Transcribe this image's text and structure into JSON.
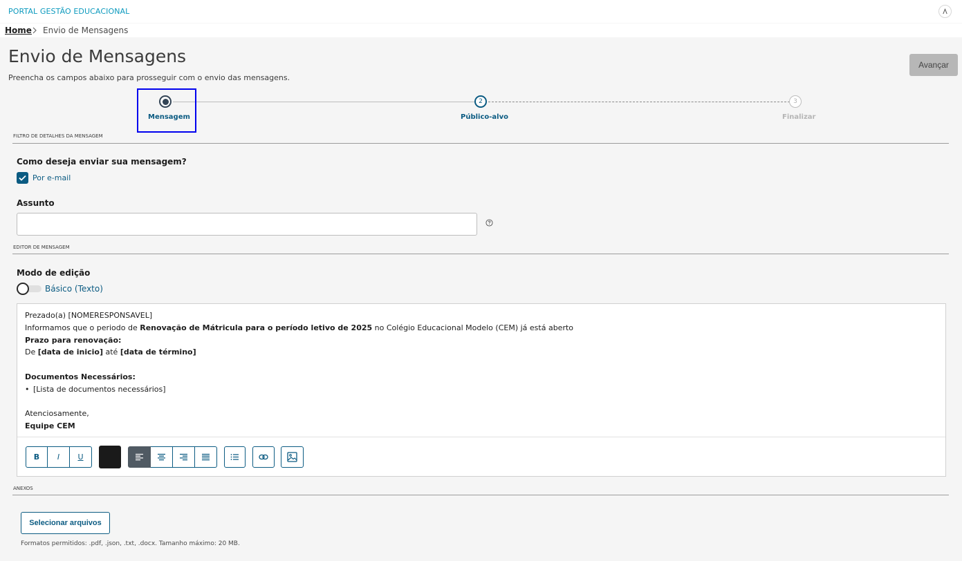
{
  "header": {
    "brand": "PORTAL GESTÃO EDUCACIONAL",
    "user_icon": "user-icon"
  },
  "breadcrumb": {
    "home": "Home",
    "current": "Envio de Mensagens",
    "separator_icon": "chevron-right-icon"
  },
  "page": {
    "title": "Envio de Mensagens",
    "subtitle": "Preencha os campos abaixo para prosseguir com o envio das mensagens.",
    "next_button": "Avançar"
  },
  "stepper": {
    "steps": [
      {
        "label": "Mensagem",
        "number": "",
        "state": "current"
      },
      {
        "label": "Público-alvo",
        "number": "2",
        "state": "next"
      },
      {
        "label": "Finalizar",
        "number": "3",
        "state": "disabled"
      }
    ]
  },
  "filter_section": {
    "title": "FILTRO DE DETALHES DA MENSAGEM",
    "send_question": "Como deseja enviar sua mensagem?",
    "email_option": "Por e-mail",
    "email_checked": true,
    "subject_label": "Assunto",
    "subject_value": "",
    "subject_placeholder": "",
    "help_icon": "question-circle-icon"
  },
  "editor_section": {
    "title": "EDITOR DE MENSAGEM",
    "mode_label": "Modo de edição",
    "mode_toggle_label": "Básico (Texto)",
    "mode_toggle_on": false,
    "content": {
      "line1": "Prezado(a) [NOMERESPONSAVEL]",
      "line2_pre": "Informamos que o periodo de ",
      "line2_bold": "Renovação de Mátricula para o período letivo de 2025",
      "line2_post": " no Colégio Educacional Modelo (CEM) já está aberto",
      "deadline_heading": "Prazo para renovação:",
      "deadline_pre": "De ",
      "deadline_start": "[data de inicio]",
      "deadline_mid": " até ",
      "deadline_end": "[data de término]",
      "docs_heading": "Documentos Necessários:",
      "docs_item": "[Lista de documentos necessários]",
      "closing": "Atenciosamente,",
      "signature": "Equipe CEM"
    },
    "toolbar": {
      "bold": "B",
      "italic": "I",
      "underline": "U",
      "text_color": "#1a1a1a",
      "icons": [
        "align-left-icon",
        "align-center-icon",
        "align-right-icon",
        "align-justify-icon",
        "list-icon",
        "link-icon",
        "image-icon"
      ]
    }
  },
  "attachments": {
    "title": "ANEXOS",
    "select_button": "Selecionar arquivos",
    "hint": "Formatos permitidos: .pdf, .json, .txt, .docx. Tamanho máximo: 20 MB."
  },
  "colors": {
    "primary": "#0b5b82",
    "brand": "#0c9abe",
    "disabled_button": "#b7b7b7",
    "highlight_box": "#0000ee"
  }
}
